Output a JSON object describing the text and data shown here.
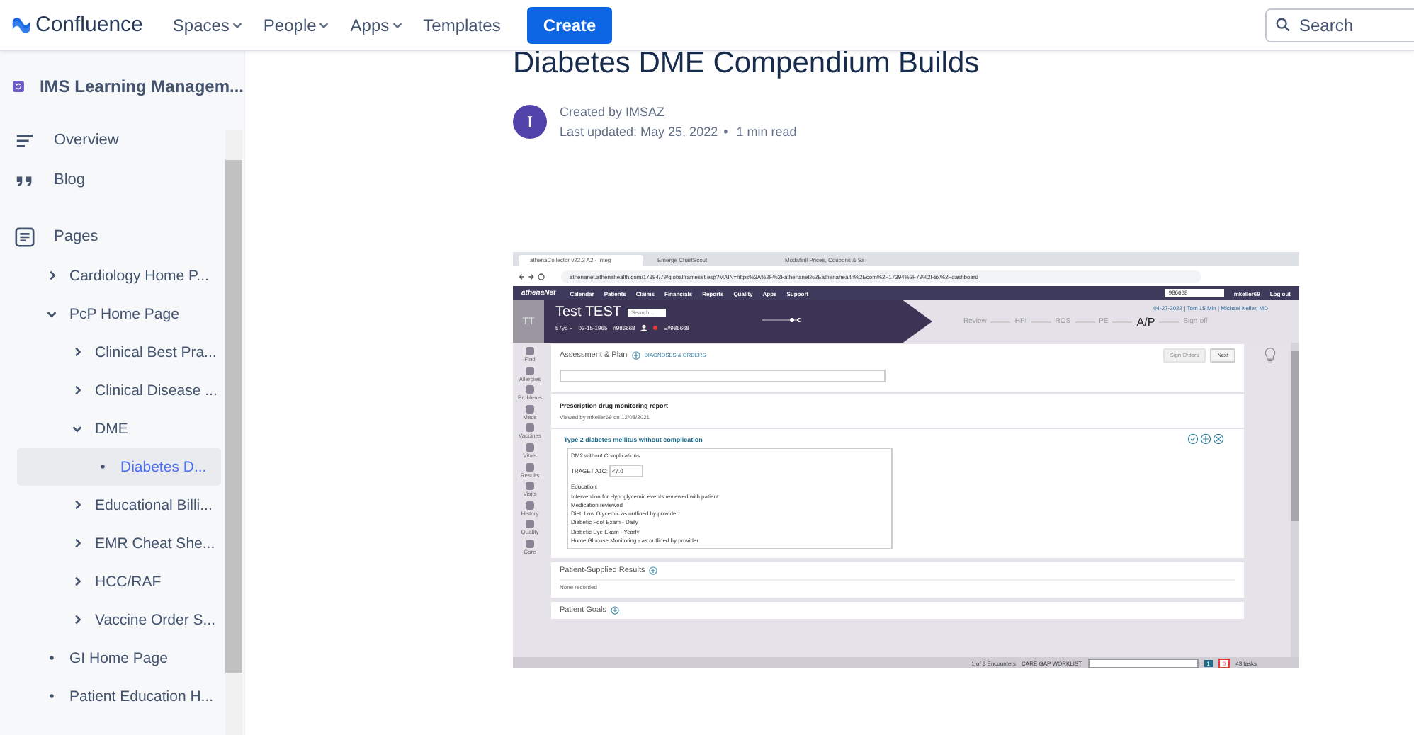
{
  "topnav": {
    "logo": "Confluence",
    "items": [
      {
        "label": "Spaces",
        "kind": "menu"
      },
      {
        "label": "People",
        "kind": "menu"
      },
      {
        "label": "Apps",
        "kind": "menu"
      },
      {
        "label": "Templates",
        "kind": "link"
      }
    ],
    "create_button": "Create",
    "search": {
      "placeholder": "Search"
    }
  },
  "sidebar": {
    "space_name": "IMS Learning Managem...",
    "items": [
      {
        "label": "Overview",
        "kind": "overview"
      },
      {
        "label": "Blog",
        "kind": "blog"
      },
      {
        "label": "Pages",
        "kind": "pages"
      }
    ],
    "tree": [
      {
        "label": "Cardiology Home P...",
        "kind": "folder",
        "expanded": false,
        "selected": false
      },
      {
        "label": "PcP Home Page",
        "kind": "folder",
        "expanded": true,
        "selected": false,
        "children": [
          {
            "label": "Clinical Best Pra...",
            "kind": "folder",
            "expanded": false,
            "selected": false
          },
          {
            "label": "Clinical Disease ...",
            "kind": "folder",
            "expanded": false,
            "selected": false
          },
          {
            "label": "DME",
            "kind": "folder",
            "expanded": true,
            "selected": false,
            "children": [
              {
                "label": "Diabetes D...",
                "kind": "page",
                "selected": true
              }
            ]
          },
          {
            "label": "Educational Billi...",
            "kind": "folder",
            "expanded": false,
            "selected": false
          },
          {
            "label": "EMR Cheat She...",
            "kind": "folder",
            "expanded": false,
            "selected": false
          },
          {
            "label": "HCC/RAF",
            "kind": "folder",
            "expanded": false,
            "selected": false
          },
          {
            "label": "Vaccine Order S...",
            "kind": "folder",
            "expanded": false,
            "selected": false
          }
        ]
      },
      {
        "label": "GI Home Page",
        "kind": "page",
        "selected": false
      },
      {
        "label": "Patient Education H...",
        "kind": "page",
        "selected": false
      }
    ]
  },
  "page": {
    "title": "Diabetes DME Compendium Builds",
    "avatar_letter": "I",
    "created_by": "Created by IMSAZ",
    "last_updated": "Last updated: May 25, 2022",
    "separator": "•",
    "read_time": "1 min read"
  },
  "screenshot": {
    "browser_tabs": [
      {
        "title": "athenaCollector v22.3 A2 - Integ",
        "selected": true
      },
      {
        "title": "Emerge ChartScout",
        "selected": false
      },
      {
        "title": "Modafinil Prices, Coupons & Sa",
        "selected": false
      }
    ],
    "url": "athenanet.athenahealth.com/17394/79/globalframeset.esp?MAIN=https%3A%2F%2Fathenanet%2Eathenahealth%2Ecom%2F17394%2F79%2Fax%2Fdashboard",
    "app_logo": "athenaNet",
    "app_menu": [
      "Calendar",
      "Patients",
      "Claims",
      "Financials",
      "Reports",
      "Quality",
      "Apps",
      "Support"
    ],
    "patient_lookup": "986668",
    "user": "mkeller69",
    "logout": "Log out",
    "patient": {
      "initials": "TT",
      "name": "Test TEST",
      "search_placeholder": "Search...",
      "age": "57yo F",
      "dob": "03-15-1965",
      "id": "#986668",
      "enterprise_id": "E#986668"
    },
    "steps": [
      {
        "label": "Review",
        "selected": false
      },
      {
        "label": "HPI",
        "selected": false
      },
      {
        "label": "ROS",
        "selected": false
      },
      {
        "label": "PE",
        "selected": false
      },
      {
        "label": "A/P",
        "selected": true
      },
      {
        "label": "Sign-off",
        "selected": false
      }
    ],
    "encounter": "04-27-2022 | Tom 15 Min | Michael Keller, MD",
    "tools": [
      "Find",
      "Allergies",
      "Problems",
      "Meds",
      "Vaccines",
      "Vitals",
      "Results",
      "Visits",
      "History",
      "Quality",
      "Care"
    ],
    "section_title": "Assessment & Plan",
    "add_link": "DIAGNOSES & ORDERS",
    "buttons": [
      {
        "label": "Sign Orders",
        "disabled": true
      },
      {
        "label": "Next",
        "disabled": false
      }
    ],
    "pdmp": {
      "title": "Prescription drug monitoring report",
      "note": "Viewed by mkeller69 on 12/08/2021"
    },
    "diagnosis": {
      "title": "Type 2 diabetes mellitus without complication",
      "line": "DM2 without Complications",
      "target_label": "TRAGET A1C:",
      "target_value": "<7.0",
      "lines": [
        "Education:",
        "Intervention for Hypoglycemic events reviewed with patient",
        "Medication reviewed",
        "Diet: Low Glycemic as outlined by provider",
        "Diabetic Foot Exam - Daily",
        "Diabetic Eye Exam - Yearly",
        "Home Glucose Monitoring - as outlined by provider"
      ]
    },
    "results": {
      "title": "Patient-Supplied Results",
      "note": "None recorded"
    },
    "goals": {
      "title": "Patient Goals"
    },
    "status": {
      "encounters": "1 of 3 Encounters",
      "worklist": "CARE GAP WORKLIST",
      "count_a": "1",
      "count_b": "0",
      "tasks": "43 tasks"
    }
  }
}
